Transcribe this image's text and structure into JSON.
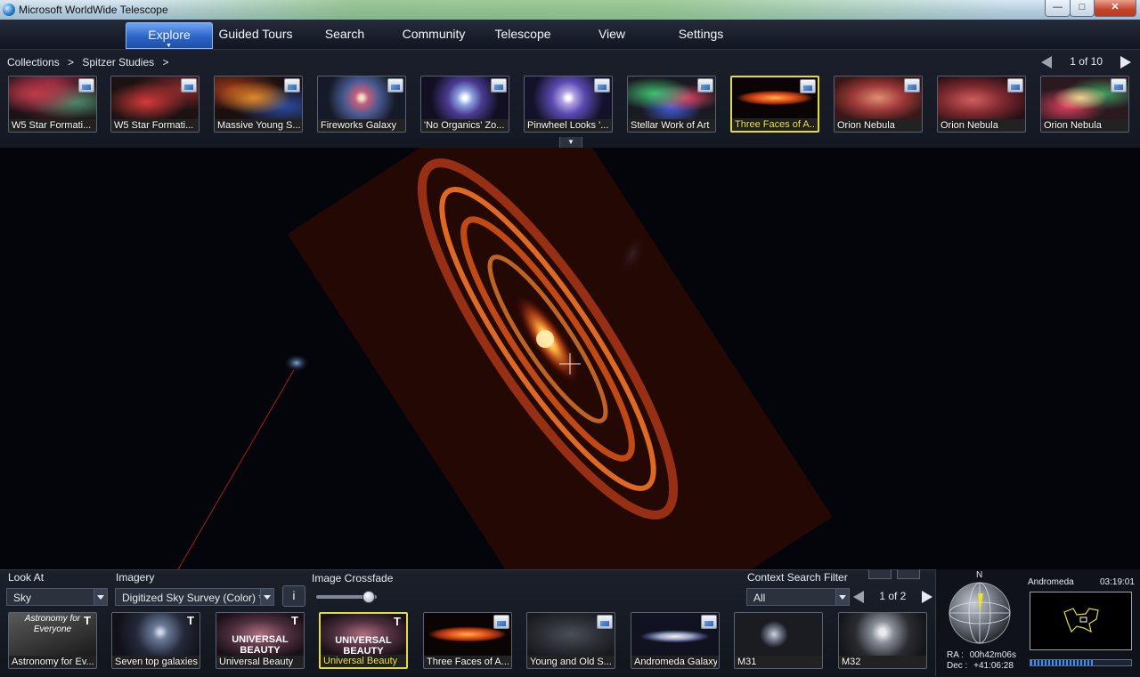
{
  "window": {
    "title": "Microsoft WorldWide Telescope",
    "minimize": "—",
    "maximize": "□",
    "close": "✕"
  },
  "menu": {
    "items": [
      {
        "label": "Explore",
        "active": true
      },
      {
        "label": "Guided Tours"
      },
      {
        "label": "Search"
      },
      {
        "label": "Community"
      },
      {
        "label": "Telescope"
      },
      {
        "label": "View"
      },
      {
        "label": "Settings"
      }
    ]
  },
  "breadcrumb": {
    "root": "Collections",
    "sep1": ">",
    "current": "Spitzer Studies",
    "sep2": ">"
  },
  "top_pager": {
    "text": "1 of 10"
  },
  "collection_thumbs": [
    {
      "label": "W5 Star Formati...",
      "icon": "image-icon"
    },
    {
      "label": "W5 Star Formati...",
      "icon": "image-icon"
    },
    {
      "label": "Massive Young S...",
      "icon": "image-icon"
    },
    {
      "label": "Fireworks Galaxy",
      "icon": "image-icon"
    },
    {
      "label": "'No Organics' Zo...",
      "icon": "image-icon"
    },
    {
      "label": "Pinwheel Looks '...",
      "icon": "image-icon"
    },
    {
      "label": "Stellar Work of Art",
      "icon": "image-icon"
    },
    {
      "label": "Three Faces of A...",
      "icon": "image-icon",
      "selected": true
    },
    {
      "label": "Orion Nebula",
      "icon": "image-icon"
    },
    {
      "label": "Orion Nebula",
      "icon": "image-icon"
    },
    {
      "label": "Orion Nebula",
      "icon": "image-icon"
    }
  ],
  "controls": {
    "look_at": {
      "label": "Look At",
      "value": "Sky"
    },
    "imagery": {
      "label": "Imagery",
      "value": "Digitized Sky Survey (Color) *"
    },
    "info": "i",
    "crossfade": {
      "label": "Image Crossfade",
      "level": 0.85
    },
    "context_filter": {
      "label": "Context Search Filter",
      "value": "All"
    },
    "bottom_pager": {
      "text": "1 of 2"
    }
  },
  "context_thumbs": [
    {
      "label": "Astronomy for Ev...",
      "overlay": "Astronomy for Everyone",
      "icon": "tour-icon"
    },
    {
      "label": "Seven top galaxies",
      "icon": "tour-icon"
    },
    {
      "label": "Universal Beauty",
      "overlay": "UNIVERSAL BEAUTY",
      "icon": "tour-icon"
    },
    {
      "label": "Universal Beauty",
      "overlay": "UNIVERSAL BEAUTY",
      "icon": "tour-icon",
      "selected": true
    },
    {
      "label": "Three Faces of A...",
      "icon": "image-icon"
    },
    {
      "label": "Young and Old S...",
      "icon": "image-icon"
    },
    {
      "label": "Andromeda Galaxy",
      "icon": "image-icon"
    },
    {
      "label": "M31"
    },
    {
      "label": "M32"
    }
  ],
  "compass": {
    "north": "N",
    "constellation": "Andromeda",
    "time": "03:19:01",
    "ra_label": "RA :",
    "ra_value": "00h42m06s",
    "dec_label": "Dec :",
    "dec_value": "+41:06:28"
  },
  "colors": {
    "accent": "#2d64c8",
    "selection": "#e4dc3c",
    "galaxy": "#ff6a1a"
  }
}
